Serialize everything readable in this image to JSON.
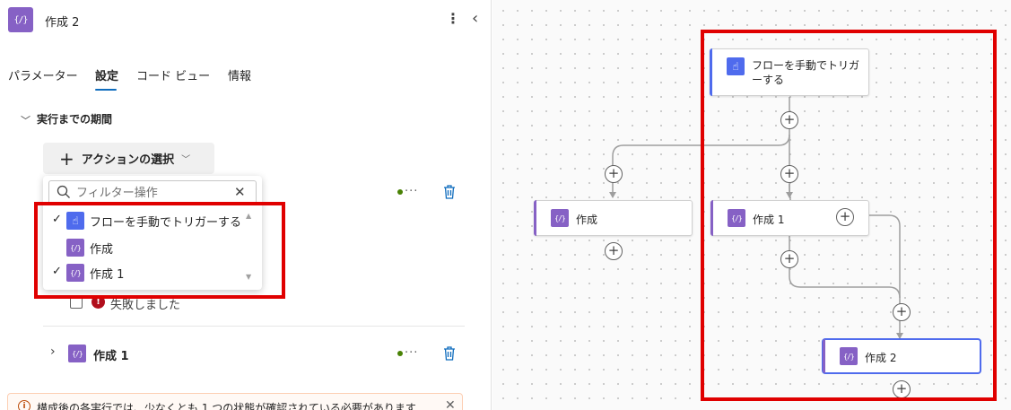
{
  "header": {
    "icon": "compose-icon",
    "icon_text": "{/}",
    "title": "作成 2"
  },
  "tabs": [
    {
      "label": "パラメーター",
      "active": false
    },
    {
      "label": "設定",
      "active": true
    },
    {
      "label": "コード ビュー",
      "active": false
    },
    {
      "label": "情報",
      "active": false
    }
  ],
  "section": {
    "title": "実行までの期間"
  },
  "action_select": {
    "label": "アクションの選択"
  },
  "filter": {
    "placeholder": "フィルター操作"
  },
  "dropdown_items": [
    {
      "label": "フローを手動でトリガーする",
      "checked": true,
      "icon": "trigger-icon"
    },
    {
      "label": "作成",
      "checked": false,
      "icon": "compose-icon"
    },
    {
      "label": "作成 1",
      "checked": true,
      "icon": "compose-icon"
    }
  ],
  "run_after_rows": [
    {
      "status_text": "失敗しました"
    },
    {
      "label": "作成 1"
    }
  ],
  "warning": {
    "text": "構成後の各実行では、少なくとも 1 つの状態が確認されている必要があります"
  },
  "flow": {
    "trigger_label": "フローを手動でトリガーする",
    "nodes": [
      "作成",
      "作成 1",
      "作成 2"
    ],
    "selected": "作成 2"
  },
  "colors": {
    "compose": "#8661c5",
    "trigger": "#4f6bed",
    "accent_tab": "#0f6cbd",
    "annotation": "#e00000"
  }
}
